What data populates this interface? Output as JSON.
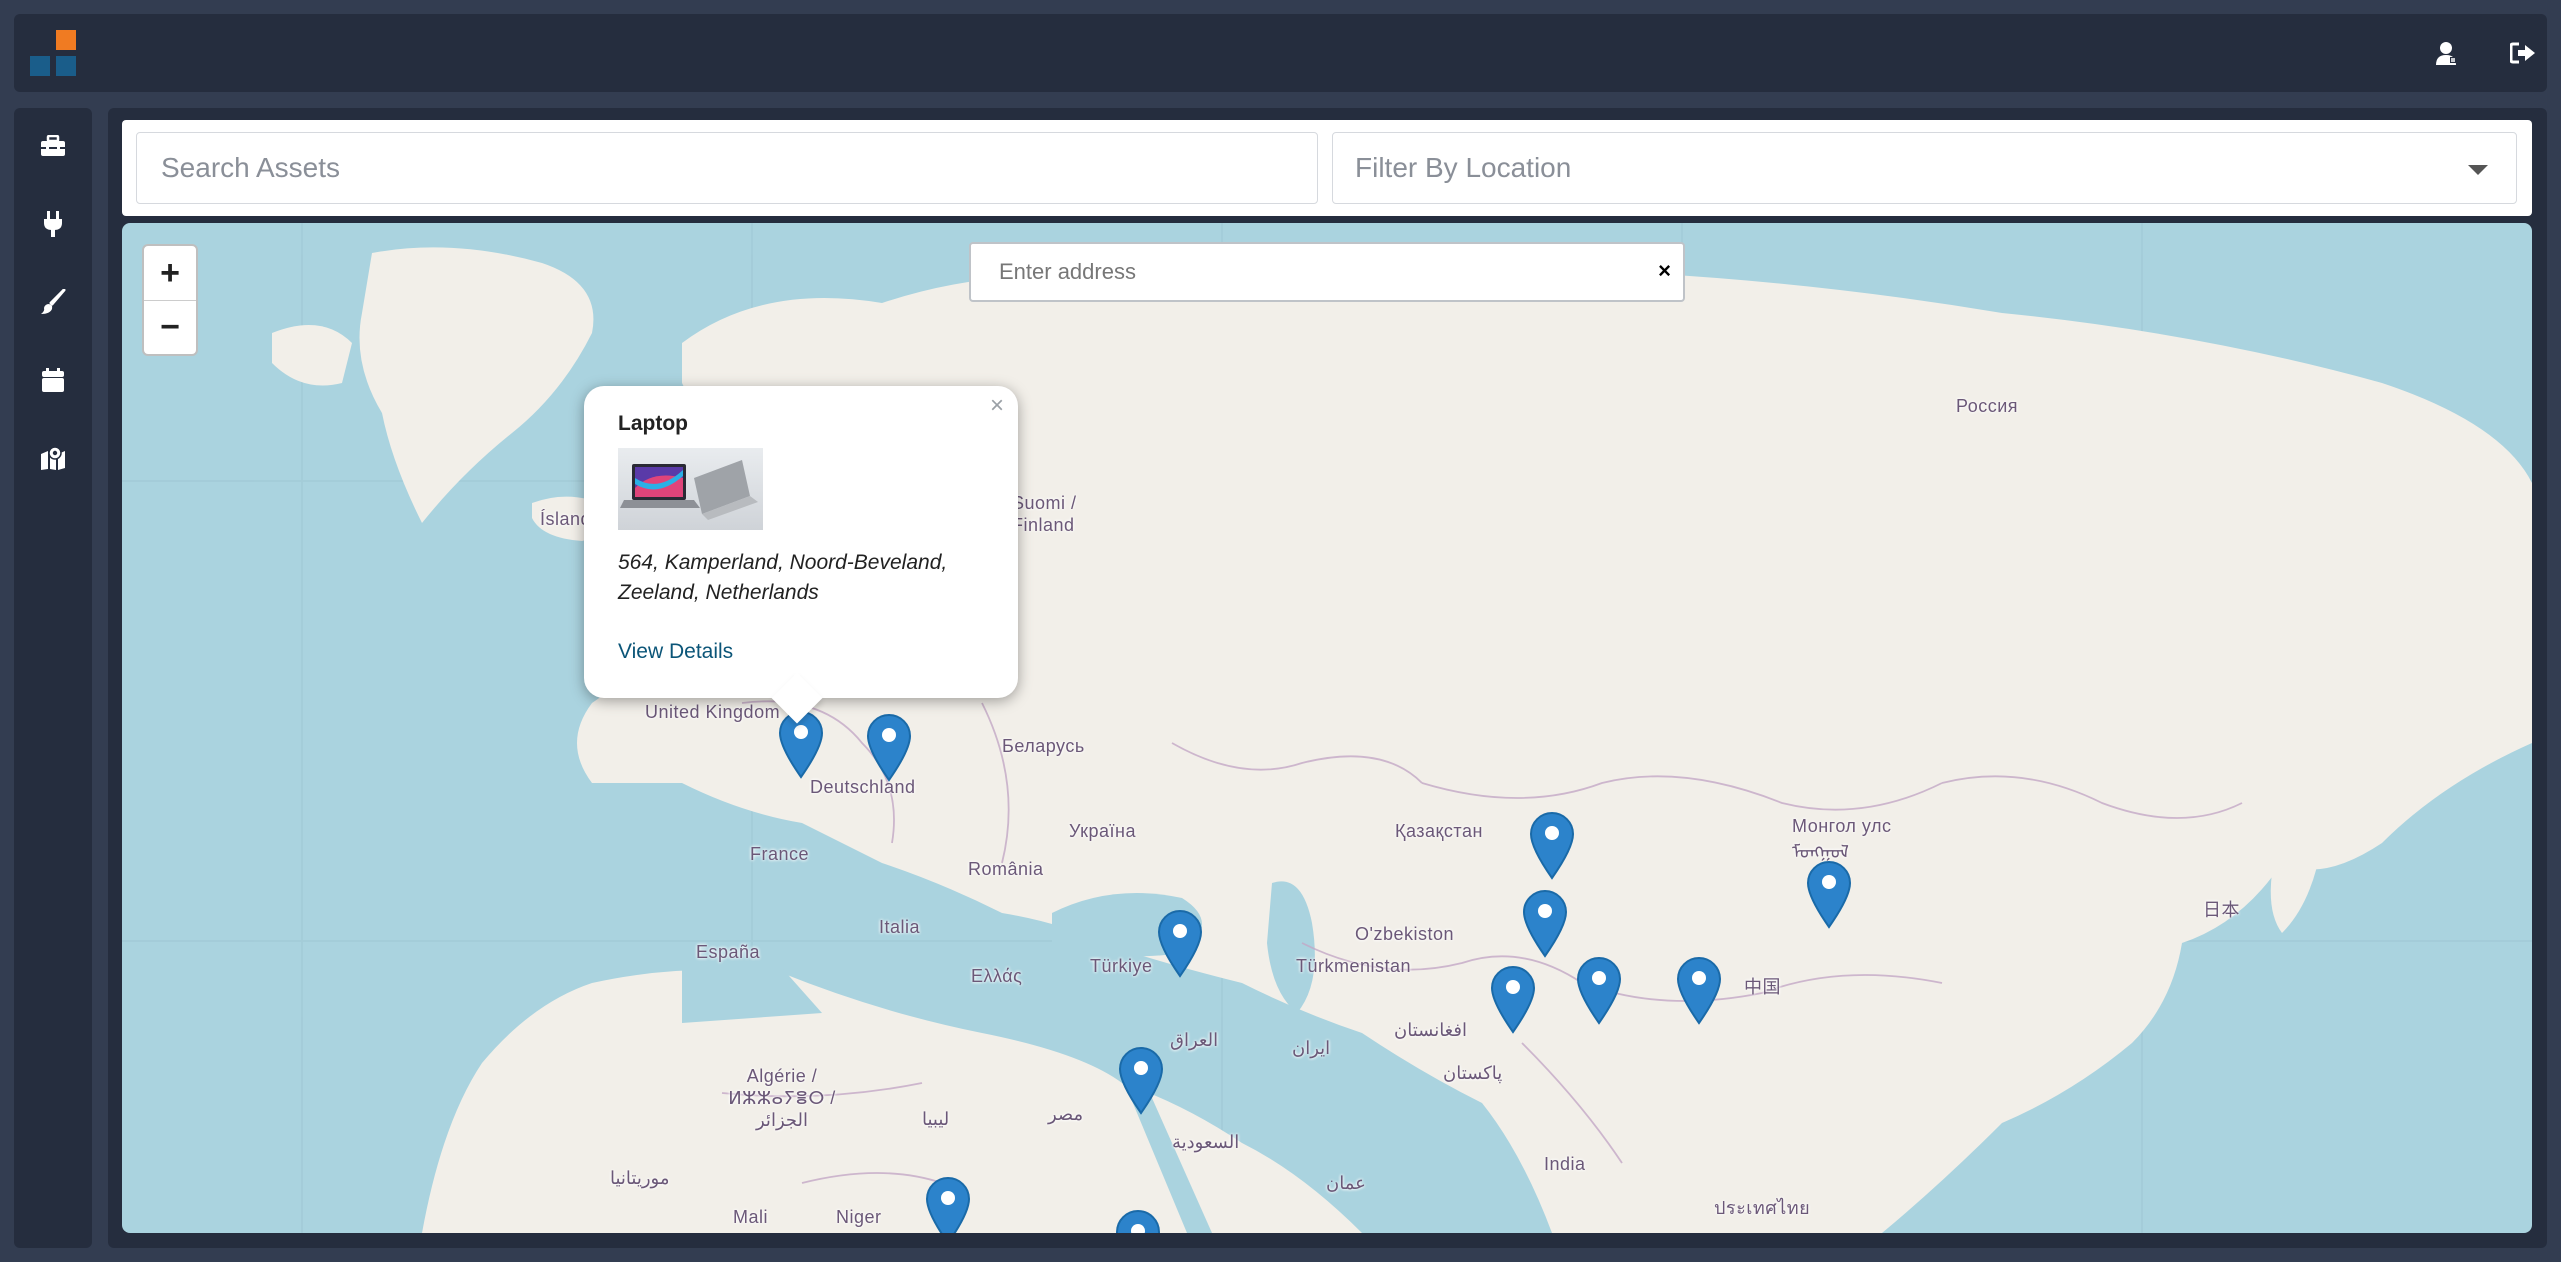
{
  "header": {
    "logo_icon": "app-logo",
    "actions": [
      {
        "name": "user-icon",
        "label": "Profile"
      },
      {
        "name": "logout-icon",
        "label": "Logout"
      }
    ]
  },
  "sidebar": {
    "items": [
      {
        "icon": "toolbox-icon"
      },
      {
        "icon": "plug-icon"
      },
      {
        "icon": "brush-icon"
      },
      {
        "icon": "calendar-icon"
      },
      {
        "icon": "map-marker-icon"
      }
    ]
  },
  "filters": {
    "search_placeholder": "Search Assets",
    "location_placeholder": "Filter By Location"
  },
  "map": {
    "address_placeholder": "Enter address",
    "address_clear": "×",
    "zoom_in": "+",
    "zoom_out": "−",
    "labels": [
      "Россия",
      "Ísland",
      "Suomi / Finland",
      "United Kingdom",
      "Беларусь",
      "Deutschland",
      "France",
      "Україна",
      "Қазақстан",
      "Монгол улс ᠮᠣᠩᠭᠣᠯ",
      "România",
      "España",
      "Italia",
      "Ελλάς",
      "Türkiye",
      "O'zbekiston",
      "Türkmenistan",
      "日本",
      "中国",
      "افغانستان",
      "العراق",
      "ایران",
      "پاکستان",
      "Algérie / ⵍⵣⵣⴰⵢⴻⵔ / الجزائر",
      "ليبيا",
      "مصر",
      "السعودية",
      "عمان",
      "India",
      "موريتانيا",
      "Mali",
      "Niger",
      "ประเทศไทย"
    ],
    "popup": {
      "title": "Laptop",
      "address": "564, Kamperland, Noord-Beveland, Zeeland, Netherlands",
      "link": "View Details",
      "close": "×"
    }
  }
}
